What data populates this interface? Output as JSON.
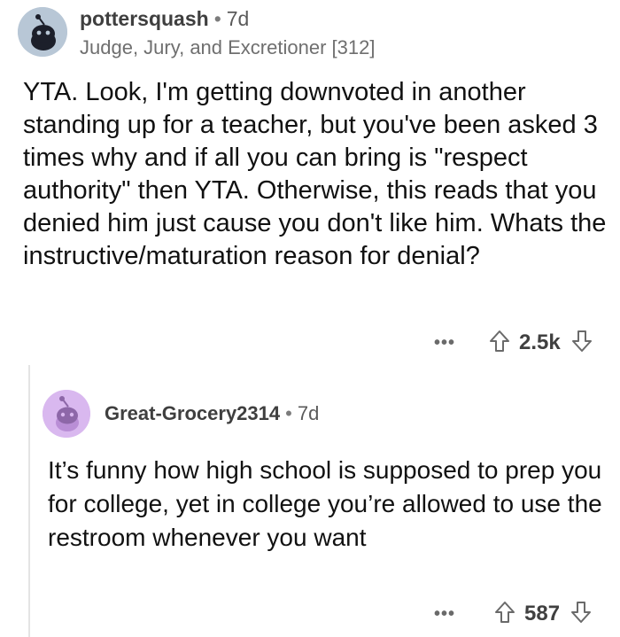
{
  "parent_comment": {
    "username": "pottersquash",
    "separator": "•",
    "age": "7d",
    "flair": "Judge, Jury, and Excretioner [312]",
    "body": "YTA. Look, I'm getting downvoted in another standing up for a teacher, but you've been asked 3 times why and if all you can bring is \"respect authority\" then YTA. Otherwise, this reads that you denied him just cause you don't like him. Whats the instructive/maturation reason for denial?",
    "more_label": "•••",
    "score": "2.5k",
    "avatar_color": "#b8c7d6",
    "icons": {
      "upvote": "upvote-arrow-icon",
      "downvote": "downvote-arrow-icon",
      "more": "more-options-icon"
    }
  },
  "reply_comment": {
    "username": "Great-Grocery2314",
    "separator": "•",
    "age": "7d",
    "body": "It’s funny how high school is supposed to prep you for college, yet in college you’re allowed to use the restroom whenever you want",
    "more_label": "•••",
    "score": "587",
    "avatar_color": "#d9b8ef"
  }
}
